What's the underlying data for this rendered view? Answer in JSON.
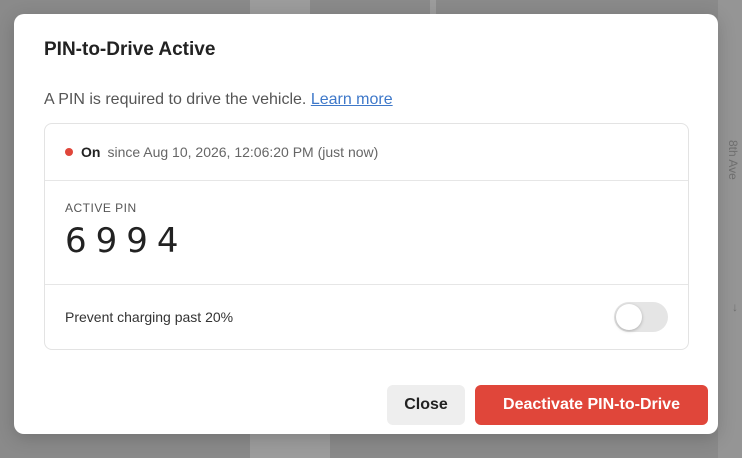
{
  "background": {
    "street_label": "8th Ave",
    "arrow_glyph": "↓"
  },
  "dialog": {
    "title": "PIN-to-Drive Active",
    "description": "A PIN is required to drive the vehicle.",
    "learn_more": "Learn more",
    "status": {
      "state": "On",
      "since": "since Aug 10, 2026, 12:06:20 PM (just now)",
      "dot_color": "#e0463a"
    },
    "pin": {
      "label": "ACTIVE PIN",
      "value": "6994"
    },
    "charging_toggle": {
      "label": "Prevent charging past 20%",
      "enabled": false
    },
    "buttons": {
      "close": "Close",
      "deactivate": "Deactivate PIN-to-Drive"
    },
    "colors": {
      "accent": "#e0463a",
      "link": "#3e78c9"
    }
  }
}
